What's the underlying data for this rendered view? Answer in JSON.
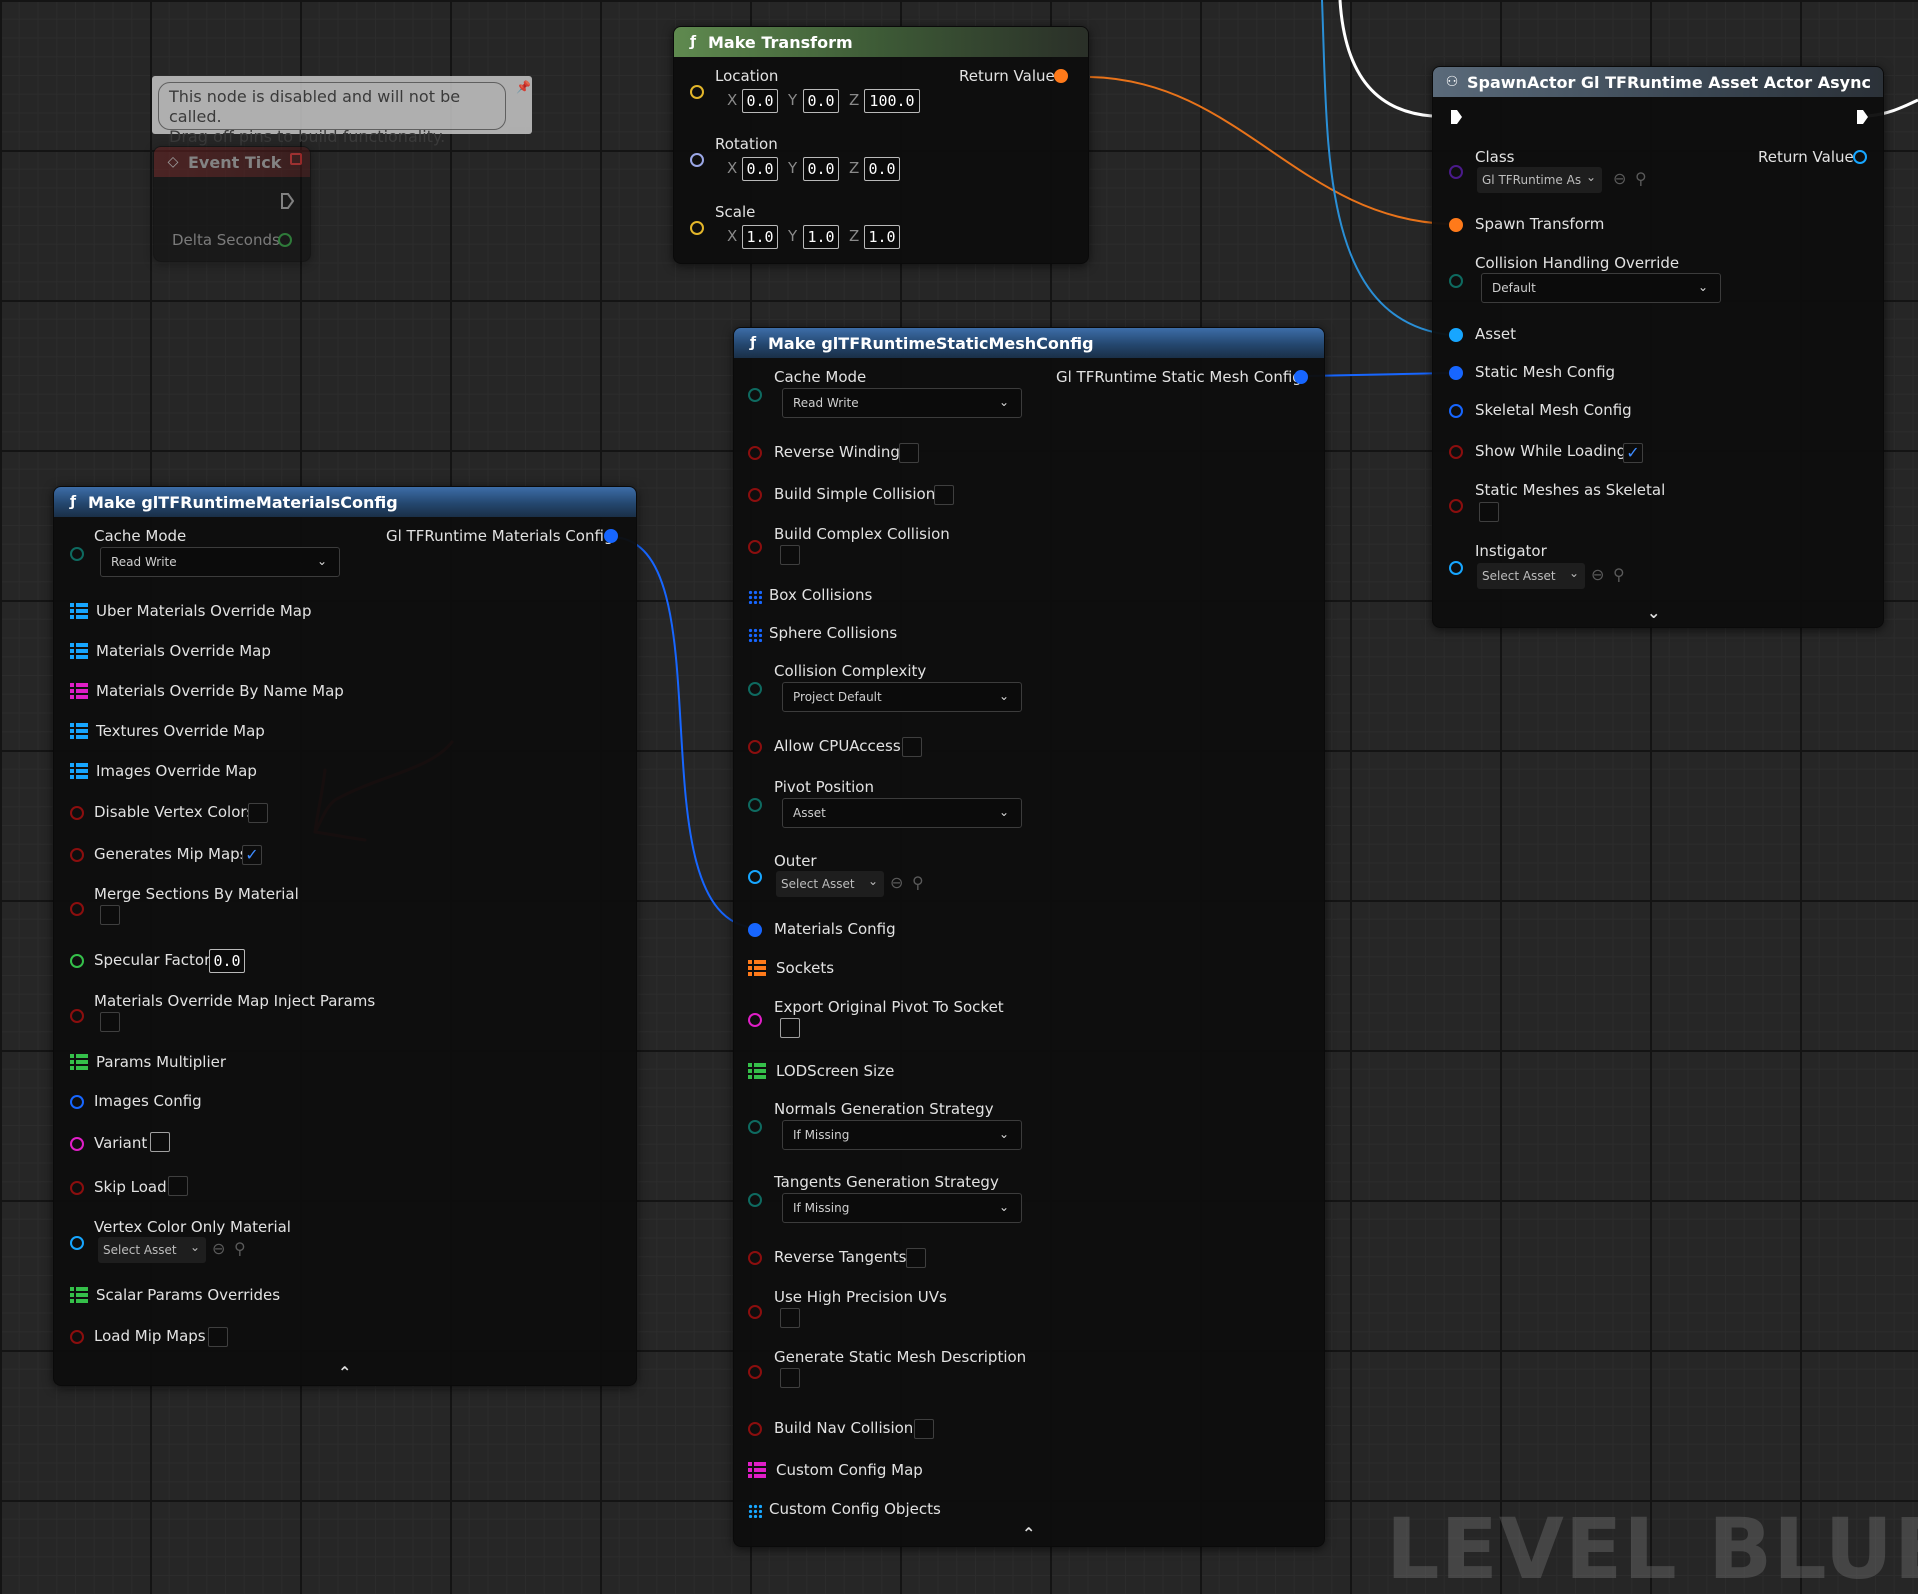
{
  "colors": {
    "wire_orange": "#ff7a1a",
    "wire_blue": "#2a9ae6",
    "wire_white": "#ffffff",
    "pin_struct_blue": "#1766ff",
    "pin_bool_red": "#8b0e0e",
    "pin_enum_teal": "#0e6a60",
    "pin_float_green": "#35c04a",
    "pin_object_cyan": "#17a6ff",
    "pin_class_purple": "#5a1aa0",
    "pin_pink": "#e01ec7",
    "annotation_red": "#e02a2a"
  },
  "comment": {
    "text_line1": "This node is disabled and will not be called.",
    "text_line2": "Drag off pins to build functionality."
  },
  "event_tick": {
    "title": "Event Tick",
    "delta_seconds": "Delta Seconds"
  },
  "make_transform": {
    "title": "Make Transform",
    "return_value": "Return Value",
    "location": {
      "label": "Location",
      "x": "0.0",
      "y": "0.0",
      "z": "100.0"
    },
    "rotation": {
      "label": "Rotation",
      "x": "0.0",
      "y": "0.0",
      "z": "0.0"
    },
    "scale": {
      "label": "Scale",
      "x": "1.0",
      "y": "1.0",
      "z": "1.0"
    },
    "axis_x": "X",
    "axis_y": "Y",
    "axis_z": "Z"
  },
  "spawn_actor": {
    "title": "SpawnActor Gl TFRuntime Asset Actor Async",
    "class_label": "Class",
    "class_value": "Gl TFRuntime As",
    "return_value": "Return Value",
    "spawn_transform": "Spawn Transform",
    "collision_handling": "Collision Handling Override",
    "collision_handling_value": "Default",
    "asset": "Asset",
    "static_mesh_config": "Static Mesh Config",
    "skeletal_mesh_config": "Skeletal Mesh Config",
    "show_while_loading": "Show While Loading",
    "show_while_loading_checked": true,
    "static_meshes_as_skeletal": "Static Meshes as Skeletal",
    "instigator": "Instigator",
    "instigator_value": "Select Asset"
  },
  "static_mesh_config": {
    "title": "Make glTFRuntimeStaticMeshConfig",
    "output": "Gl TFRuntime Static Mesh Config",
    "cache_mode": "Cache Mode",
    "cache_mode_value": "Read Write",
    "reverse_winding": "Reverse Winding",
    "build_simple_collision": "Build Simple Collision",
    "build_complex_collision": "Build Complex Collision",
    "box_collisions": "Box Collisions",
    "sphere_collisions": "Sphere Collisions",
    "collision_complexity": "Collision Complexity",
    "collision_complexity_value": "Project Default",
    "allow_cpu_access": "Allow CPUAccess",
    "pivot_position": "Pivot Position",
    "pivot_position_value": "Asset",
    "outer": "Outer",
    "outer_value": "Select Asset",
    "materials_config": "Materials Config",
    "sockets": "Sockets",
    "export_original_pivot": "Export Original Pivot To Socket",
    "lod_screen_size": "LODScreen Size",
    "normals_strategy": "Normals Generation Strategy",
    "normals_strategy_value": "If Missing",
    "tangents_strategy": "Tangents Generation Strategy",
    "tangents_strategy_value": "If Missing",
    "reverse_tangents": "Reverse Tangents",
    "use_high_precision_uvs": "Use High Precision UVs",
    "generate_static_mesh_description": "Generate Static Mesh Description",
    "build_nav_collision": "Build Nav Collision",
    "custom_config_map": "Custom Config Map",
    "custom_config_objects": "Custom Config Objects"
  },
  "materials_config": {
    "title": "Make glTFRuntimeMaterialsConfig",
    "output": "Gl TFRuntime Materials Config",
    "cache_mode": "Cache Mode",
    "cache_mode_value": "Read Write",
    "uber_materials_override_map": "Uber Materials Override Map",
    "materials_override_map": "Materials Override Map",
    "materials_override_by_name_map": "Materials Override By Name Map",
    "textures_override_map": "Textures Override Map",
    "images_override_map": "Images Override Map",
    "disable_vertex_colors": "Disable Vertex Colors",
    "generates_mip_maps": "Generates Mip Maps",
    "generates_mip_maps_checked": true,
    "merge_sections_by_material": "Merge Sections By Material",
    "specular_factor": "Specular Factor",
    "specular_factor_value": "0.0",
    "materials_override_map_inject_params": "Materials Override Map Inject Params",
    "params_multiplier": "Params Multiplier",
    "images_config": "Images Config",
    "variant": "Variant",
    "skip_load": "Skip Load",
    "vertex_color_only_material": "Vertex Color Only Material",
    "vertex_color_only_material_value": "Select Asset",
    "scalar_params_overrides": "Scalar Params Overrides",
    "load_mip_maps": "Load Mip Maps"
  },
  "watermark": "LEVEL BLUEPRIN"
}
